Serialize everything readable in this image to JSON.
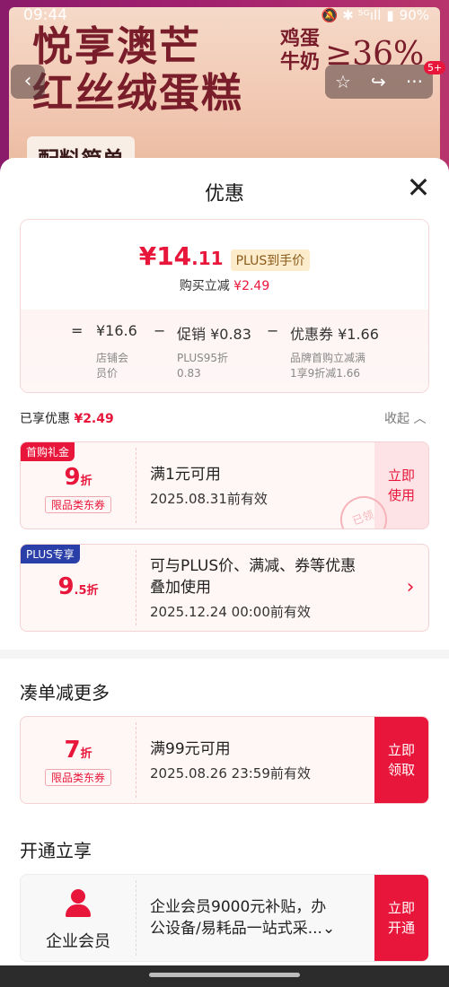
{
  "status_bar": {
    "time": "09:44",
    "icons": "🔕 ✱ ⁵ᴳıll",
    "battery": "90%"
  },
  "background": {
    "title": "悦享澳芒\n红丝绒蛋糕",
    "egg_milk": "鸡蛋\n牛奶",
    "percent": "≥36%",
    "tag": "配料简单",
    "badge": "5+"
  },
  "sheet": {
    "title": "优惠",
    "close": "✕",
    "price_card": {
      "price_symbol": "¥",
      "price_int": "14",
      "price_cents": ".11",
      "plus_tag": "PLUS到手价",
      "reduce_label": "购买立减",
      "reduce_value": "¥2.49",
      "eq": "=",
      "shop_price": "¥16.6",
      "minus1": "−",
      "promo": "促销 ¥0.83",
      "minus2": "−",
      "coupon_amt": "优惠券 ¥1.66",
      "shop_label": "店铺会\n员价",
      "promo_sub": "PLUS95折\n0.83",
      "coupon_sub": "品牌首购立减满\n1享9折减1.66"
    },
    "enjoyed": {
      "label": "已享优惠",
      "value": "¥2.49",
      "collapse": "收起 ︿"
    },
    "coupons": [
      {
        "ribbon": "首购礼金",
        "disc": "9",
        "unit": "折",
        "cat": "限品类东券",
        "t1": "满1元可用",
        "t2": "2025.08.31前有效",
        "action": "立即\n使用"
      },
      {
        "ribbon": "PLUS专享",
        "disc": "9",
        "disc_dec": ".5",
        "unit": "折",
        "t1": "可与PLUS价、满减、券等优惠\n叠加使用",
        "t2": "2025.12.24 00:00前有效",
        "action": "›"
      }
    ],
    "more_section": {
      "title": "凑单减更多",
      "coupon": {
        "disc": "7",
        "unit": "折",
        "cat": "限品类东券",
        "t1": "满99元可用",
        "t2": "2025.08.26 23:59前有效",
        "action": "立即\n领取"
      }
    },
    "open_section": {
      "title": "开通立享",
      "card": {
        "label": "企业会员",
        "text": "企业会员9000元补贴，办\n公设备/易耗品一站式采...⌄",
        "action": "立即\n开通"
      }
    },
    "stamp": "已领"
  },
  "colors": {
    "accent": "#e8163a",
    "plus_blue": "#2a3fa8"
  }
}
